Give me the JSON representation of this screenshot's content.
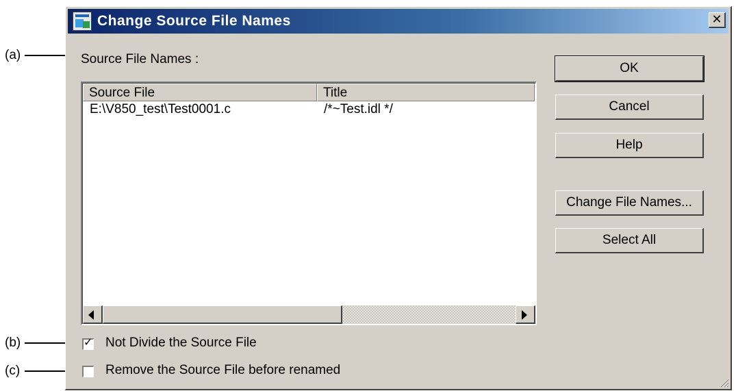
{
  "callouts": {
    "a": "(a)",
    "b": "(b)",
    "c": "(c)"
  },
  "dialog": {
    "title": "Change Source File Names",
    "close_icon": "close-icon"
  },
  "source_files_label": "Source File Names :",
  "list": {
    "columns": [
      "Source File",
      "Title"
    ],
    "rows": [
      {
        "source_file": "E:\\V850_test\\Test0001.c",
        "title": "/*~Test.idl */"
      }
    ]
  },
  "buttons": {
    "ok": "OK",
    "cancel": "Cancel",
    "help": "Help",
    "change_file_names": "Change File Names...",
    "select_all": "Select All"
  },
  "options": {
    "not_divide": {
      "label": "Not Divide the Source File",
      "checked": true
    },
    "remove_before_renamed": {
      "label": "Remove the Source File before renamed",
      "checked": false
    }
  }
}
